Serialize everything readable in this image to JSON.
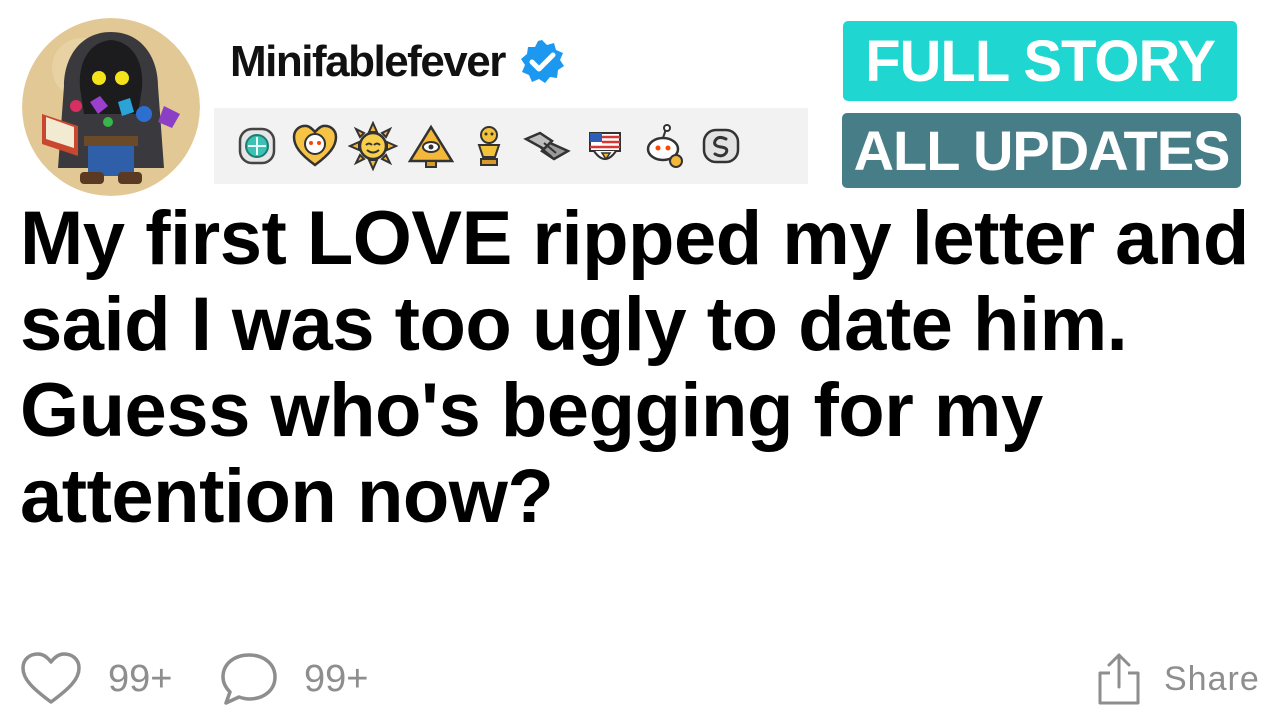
{
  "post": {
    "username": "Minifablefever",
    "title": "My first LOVE ripped my letter and said I was too ugly to date him. Guess who's begging for my attention now?"
  },
  "awards": [
    "crystal-award-icon",
    "heart-snoo-award-icon",
    "sun-award-icon",
    "pyramid-eye-award-icon",
    "gold-trophy-snoo-award-icon",
    "handshake-award-icon",
    "eagle-flag-award-icon",
    "snoo-award-icon",
    "silver-coin-award-icon"
  ],
  "badges": {
    "full_story": "FULL STORY",
    "all_updates": "ALL UPDATES"
  },
  "actions": {
    "likes": "99+",
    "comments": "99+",
    "share": "Share"
  },
  "colors": {
    "full_story_bg": "#1fd6d0",
    "all_updates_bg": "#477d87",
    "verified_blue": "#1d98f0",
    "muted_gray": "#8e8e8e"
  }
}
